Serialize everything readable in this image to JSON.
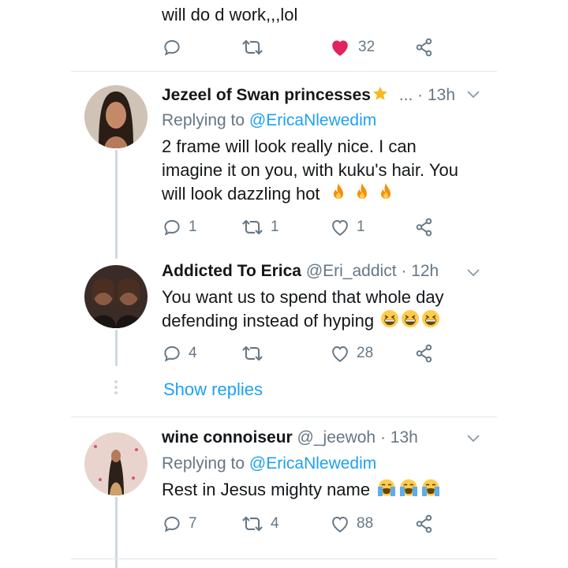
{
  "top_tweet": {
    "text": "will do d work,,,lol",
    "likes": "32"
  },
  "tweets": [
    {
      "name": "Jezeel of Swan princesses",
      "handle": "...",
      "time": "13h",
      "replying_prefix": "Replying to",
      "replying_to": "@EricaNlewedim",
      "text_lines": [
        "2 frame will look really nice. I can",
        "imagine it on you, with kuku's hair. You",
        "will look dazzling hot"
      ],
      "emoji_icon": "fire-emoji",
      "replies": "1",
      "retweets": "1",
      "likes": "1"
    },
    {
      "name": "Addicted To Erica",
      "handle": "@Eri_addict",
      "time": "12h",
      "text_lines": [
        "You want us to spend that whole day",
        "defending instead of hyping"
      ],
      "emoji_icon": "grinning-squinting-emoji",
      "replies": "4",
      "retweets": "",
      "likes": "28",
      "show_replies": "Show replies"
    },
    {
      "name": "wine connoiseur",
      "handle": "@_jeewoh",
      "time": "13h",
      "replying_prefix": "Replying to",
      "replying_to": "@EricaNlewedim",
      "text_lines": [
        "Rest in Jesus mighty name"
      ],
      "emoji_icon": "loudly-crying-emoji",
      "replies": "7",
      "retweets": "4",
      "likes": "88"
    }
  ],
  "colors": {
    "text": "#14171a",
    "muted": "#657786",
    "link": "#1da1f2",
    "like_active": "#e0245e",
    "divider": "#e1e8ed"
  }
}
